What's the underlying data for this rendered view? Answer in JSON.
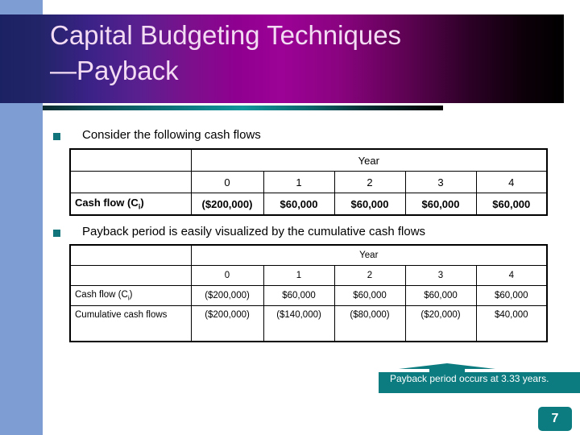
{
  "slide": {
    "title": "Capital Budgeting Techniques\n—Payback",
    "page_number": "7",
    "accent_teal": "#0d7c80",
    "sidebar_blue": "#7e9dd2",
    "title_purple": "#9c0296"
  },
  "bullets": [
    {
      "text": "Consider the following cash flows"
    },
    {
      "text": "Payback period is easily visualized by the cumulative cash flows"
    }
  ],
  "table1": {
    "year_header": "Year",
    "year_labels": [
      "0",
      "1",
      "2",
      "3",
      "4"
    ],
    "corner_blank": "",
    "rows": [
      {
        "label": "Cash flow (C",
        "label_sub": "i",
        "label_end": ")",
        "values": [
          "($200,000)",
          "$60,000",
          "$60,000",
          "$60,000",
          "$60,000"
        ]
      }
    ]
  },
  "table2": {
    "year_header": "Year",
    "year_labels": [
      "0",
      "1",
      "2",
      "3",
      "4"
    ],
    "corner_blank": "",
    "rows": [
      {
        "label": "Cash flow (C",
        "label_sub": "i",
        "label_end": ")",
        "values": [
          "($200,000)",
          "$60,000",
          "$60,000",
          "$60,000",
          "$60,000"
        ]
      },
      {
        "label": "Cumulative cash flows",
        "label_sub": "",
        "label_end": "",
        "values": [
          "($200,000)",
          "($140,000)",
          "($80,000)",
          "($20,000)",
          "$40,000"
        ]
      }
    ]
  },
  "callout": {
    "text": "Payback period occurs at 3.33 years."
  }
}
